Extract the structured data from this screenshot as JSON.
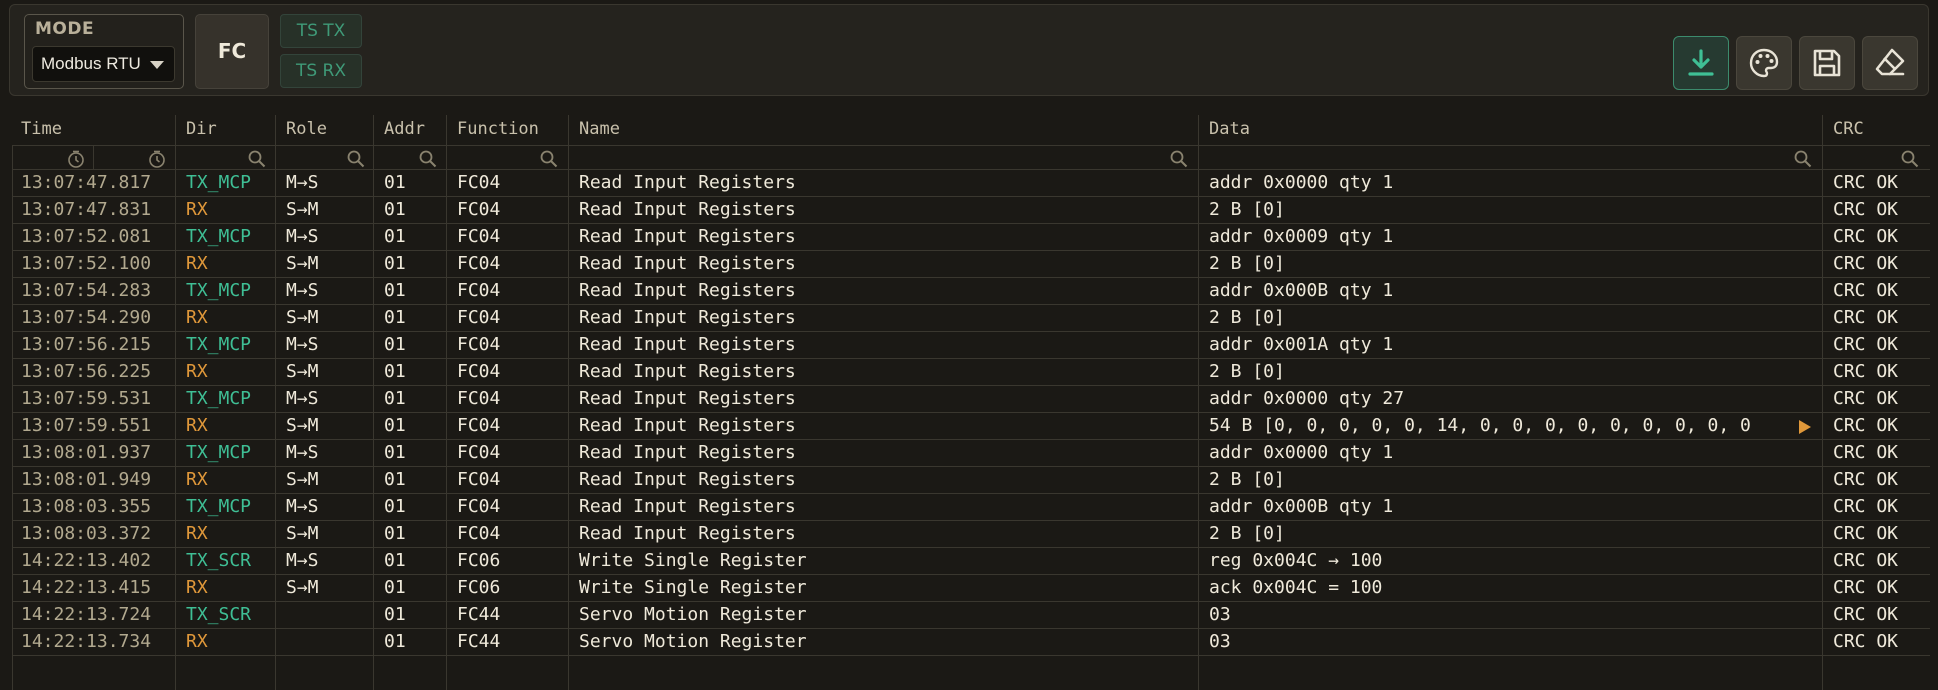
{
  "toolbar": {
    "mode_label": "MODE",
    "mode_value": "Modbus RTU",
    "fc_label": "FC",
    "ts_tx_label": "TS TX",
    "ts_rx_label": "TS RX",
    "icons": [
      "download-icon",
      "palette-icon",
      "save-icon",
      "eraser-icon"
    ],
    "accent_color": "#3fbf95"
  },
  "table": {
    "columns": [
      "Time",
      "Dir",
      "Role",
      "Addr",
      "Function",
      "Name",
      "Data",
      "CRC"
    ],
    "colors": {
      "tx": "#3fbf95",
      "rx": "#e0983a",
      "time": "#b2a98f"
    },
    "rows": [
      {
        "time": "13:07:47.817",
        "dir": "TX_MCP",
        "role": "M→S",
        "addr": "01",
        "fn": "FC04",
        "name": "Read Input Registers",
        "data": "addr 0x0000 qty 1",
        "crc": "CRC OK"
      },
      {
        "time": "13:07:47.831",
        "dir": "RX",
        "role": "S→M",
        "addr": "01",
        "fn": "FC04",
        "name": "Read Input Registers",
        "data": "2 B [0]",
        "crc": "CRC OK"
      },
      {
        "time": "13:07:52.081",
        "dir": "TX_MCP",
        "role": "M→S",
        "addr": "01",
        "fn": "FC04",
        "name": "Read Input Registers",
        "data": "addr 0x0009 qty 1",
        "crc": "CRC OK"
      },
      {
        "time": "13:07:52.100",
        "dir": "RX",
        "role": "S→M",
        "addr": "01",
        "fn": "FC04",
        "name": "Read Input Registers",
        "data": "2 B [0]",
        "crc": "CRC OK"
      },
      {
        "time": "13:07:54.283",
        "dir": "TX_MCP",
        "role": "M→S",
        "addr": "01",
        "fn": "FC04",
        "name": "Read Input Registers",
        "data": "addr 0x000B qty 1",
        "crc": "CRC OK"
      },
      {
        "time": "13:07:54.290",
        "dir": "RX",
        "role": "S→M",
        "addr": "01",
        "fn": "FC04",
        "name": "Read Input Registers",
        "data": "2 B [0]",
        "crc": "CRC OK"
      },
      {
        "time": "13:07:56.215",
        "dir": "TX_MCP",
        "role": "M→S",
        "addr": "01",
        "fn": "FC04",
        "name": "Read Input Registers",
        "data": "addr 0x001A qty 1",
        "crc": "CRC OK"
      },
      {
        "time": "13:07:56.225",
        "dir": "RX",
        "role": "S→M",
        "addr": "01",
        "fn": "FC04",
        "name": "Read Input Registers",
        "data": "2 B [0]",
        "crc": "CRC OK"
      },
      {
        "time": "13:07:59.531",
        "dir": "TX_MCP",
        "role": "M→S",
        "addr": "01",
        "fn": "FC04",
        "name": "Read Input Registers",
        "data": "addr 0x0000 qty 27",
        "crc": "CRC OK"
      },
      {
        "time": "13:07:59.551",
        "dir": "RX",
        "role": "S→M",
        "addr": "01",
        "fn": "FC04",
        "name": "Read Input Registers",
        "data": "54 B [0, 0, 0, 0, 0, 14, 0, 0, 0, 0, 0, 0, 0, 0, 0",
        "crc": "CRC OK",
        "truncated": true
      },
      {
        "time": "13:08:01.937",
        "dir": "TX_MCP",
        "role": "M→S",
        "addr": "01",
        "fn": "FC04",
        "name": "Read Input Registers",
        "data": "addr 0x0000 qty 1",
        "crc": "CRC OK"
      },
      {
        "time": "13:08:01.949",
        "dir": "RX",
        "role": "S→M",
        "addr": "01",
        "fn": "FC04",
        "name": "Read Input Registers",
        "data": "2 B [0]",
        "crc": "CRC OK"
      },
      {
        "time": "13:08:03.355",
        "dir": "TX_MCP",
        "role": "M→S",
        "addr": "01",
        "fn": "FC04",
        "name": "Read Input Registers",
        "data": "addr 0x000B qty 1",
        "crc": "CRC OK"
      },
      {
        "time": "13:08:03.372",
        "dir": "RX",
        "role": "S→M",
        "addr": "01",
        "fn": "FC04",
        "name": "Read Input Registers",
        "data": "2 B [0]",
        "crc": "CRC OK"
      },
      {
        "time": "14:22:13.402",
        "dir": "TX_SCR",
        "role": "M→S",
        "addr": "01",
        "fn": "FC06",
        "name": "Write Single Register",
        "data": "reg 0x004C → 100",
        "crc": "CRC OK"
      },
      {
        "time": "14:22:13.415",
        "dir": "RX",
        "role": "S→M",
        "addr": "01",
        "fn": "FC06",
        "name": "Write Single Register",
        "data": "ack 0x004C = 100",
        "crc": "CRC OK"
      },
      {
        "time": "14:22:13.724",
        "dir": "TX_SCR",
        "role": "",
        "addr": "01",
        "fn": "FC44",
        "name": "Servo Motion Register",
        "data": "03",
        "crc": "CRC OK"
      },
      {
        "time": "14:22:13.734",
        "dir": "RX",
        "role": "",
        "addr": "01",
        "fn": "FC44",
        "name": "Servo Motion Register",
        "data": "03",
        "crc": "CRC OK"
      }
    ]
  }
}
